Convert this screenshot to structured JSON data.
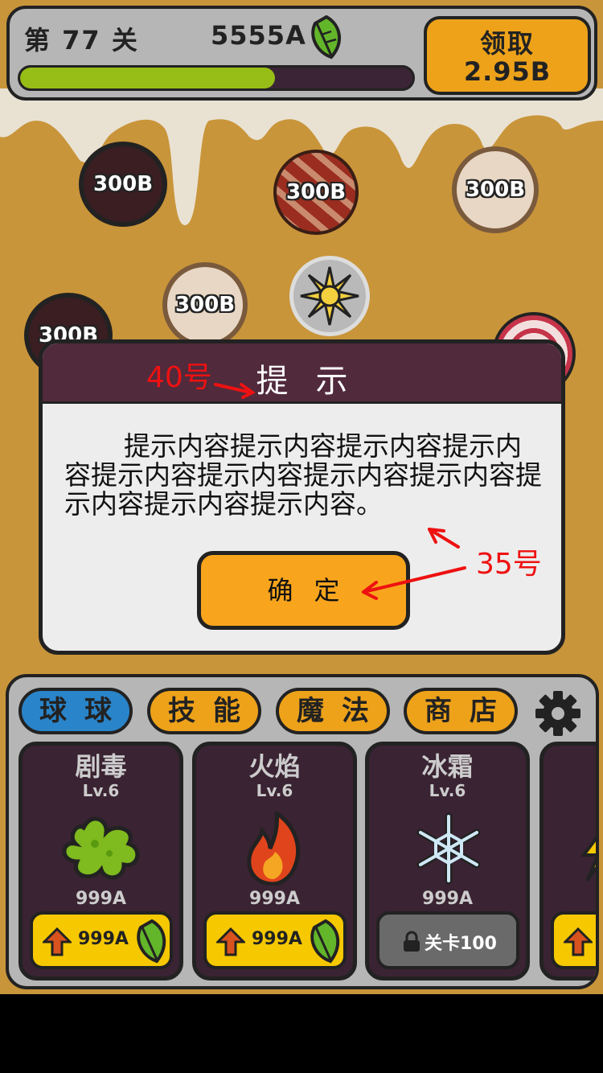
{
  "header": {
    "level_label": "第 77 关",
    "coins": "5555A",
    "progress": 0.65,
    "claim_label": "领取",
    "claim_amount": "2.95B"
  },
  "balls": [
    {
      "label": "300B",
      "style": "dark"
    },
    {
      "label": "300B",
      "style": "stripe"
    },
    {
      "label": "300B",
      "style": "cookie"
    },
    {
      "label": "300B",
      "style": "cookie"
    },
    {
      "label": "300B",
      "style": "dark"
    }
  ],
  "dialog": {
    "title": "提示",
    "body": "提示内容提示内容提示内容提示内容提示内容提示内容提示内容提示内容提示内容提示内容提示内容。",
    "ok_label": "确定"
  },
  "annotations": {
    "title_size": "40号",
    "body_size": "35号"
  },
  "tabs": [
    {
      "label": "球球",
      "active": true
    },
    {
      "label": "技能",
      "active": false
    },
    {
      "label": "魔法",
      "active": false
    },
    {
      "label": "商店",
      "active": false
    }
  ],
  "cards": [
    {
      "name": "剧毒",
      "level": "Lv.6",
      "price": "999A",
      "button": "999A",
      "icon": "poison-splat-icon"
    },
    {
      "name": "火焰",
      "level": "Lv.6",
      "price": "999A",
      "button": "999A",
      "icon": "flame-icon"
    },
    {
      "name": "冰霜",
      "level": "Lv.6",
      "price": "999A",
      "button": "关卡100",
      "icon": "snowflake-icon"
    }
  ],
  "colors": {
    "background": "#c9953a",
    "panel": "#b6b6b6",
    "accent_orange": "#eda21a",
    "dialog_header": "#512a3c",
    "active_tab": "#2a84c9",
    "progress": "#97be17",
    "annotation": "#ee1111"
  }
}
